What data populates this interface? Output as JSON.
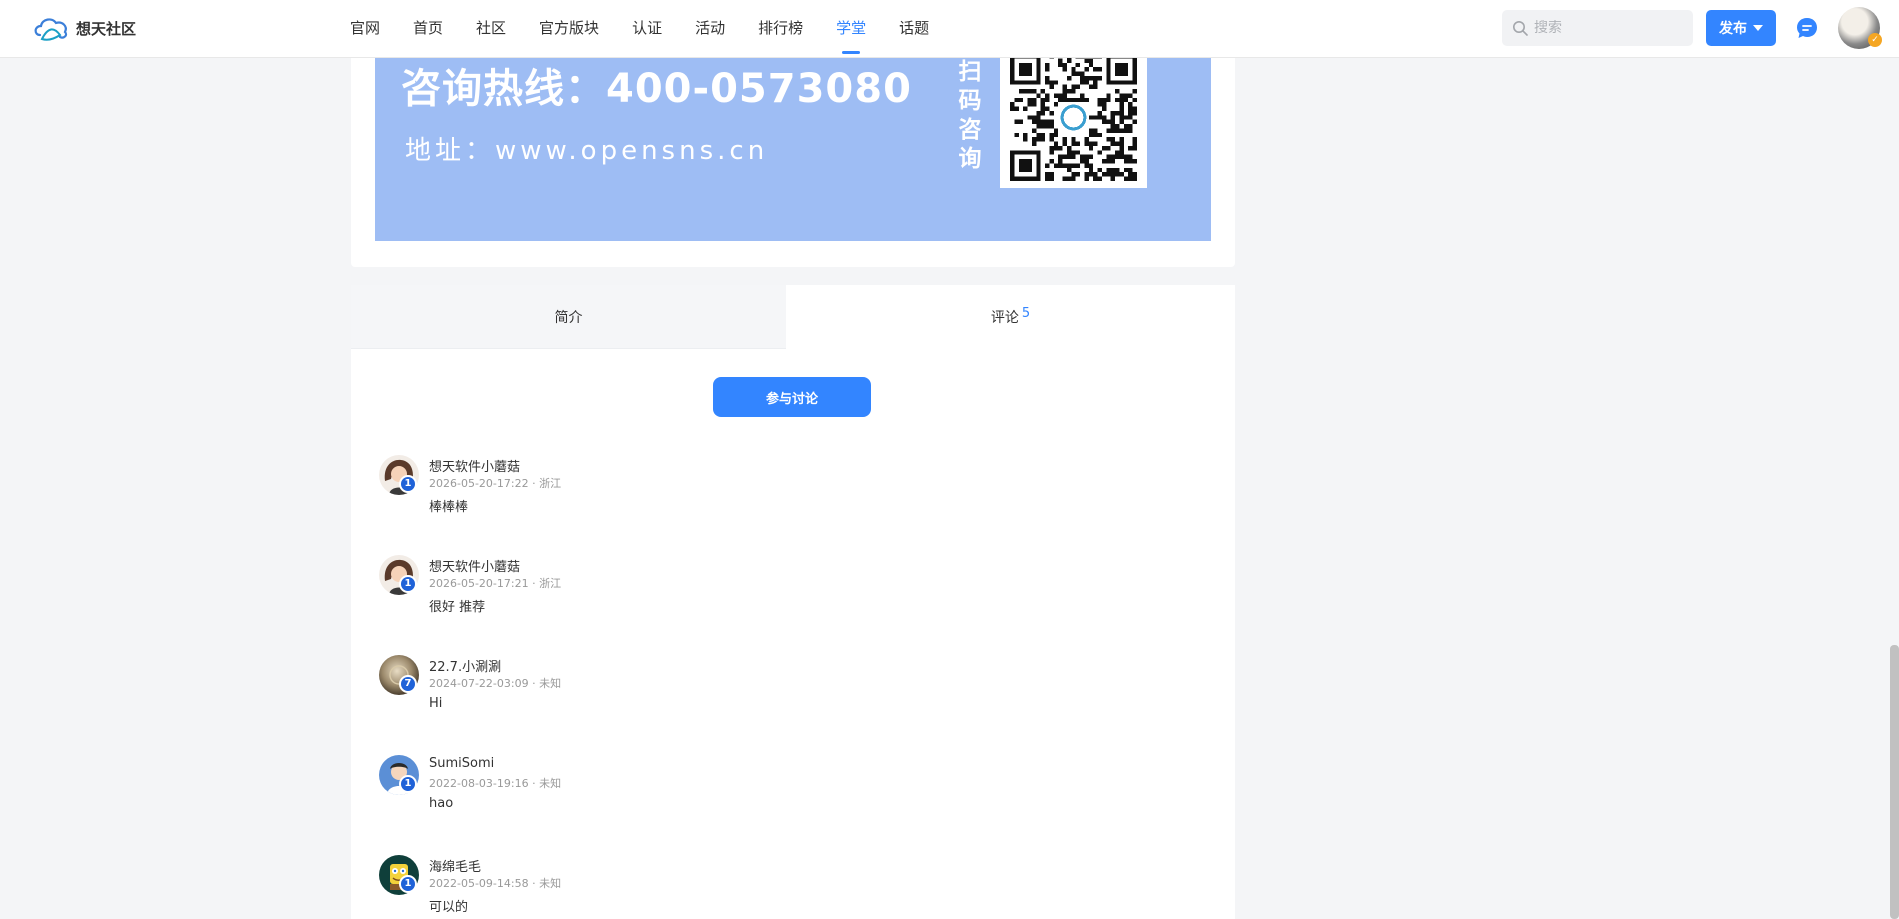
{
  "header": {
    "site_name": "想天社区",
    "nav": [
      "官网",
      "首页",
      "社区",
      "官方版块",
      "认证",
      "活动",
      "排行榜",
      "学堂",
      "话题"
    ],
    "active_nav": "学堂",
    "search_placeholder": "搜索",
    "publish_label": "发布",
    "icons": {
      "logo": "cloud-logo-icon",
      "search": "search-icon",
      "message": "chat-bubble-icon",
      "caret": "caret-down-icon"
    },
    "accent_color": "#3385ff"
  },
  "banner": {
    "hotline": "咨询热线：400-0573080",
    "address": "地址：www.opensns.cn",
    "scan_text": [
      "扫",
      "码",
      "咨",
      "询"
    ],
    "background_color": "#9ebdf4"
  },
  "tabs": {
    "intro_label": "简介",
    "comments_label": "评论",
    "comments_count": "5",
    "active": "评论"
  },
  "join_button_label": "参与讨论",
  "comments": [
    {
      "name": "想天软件小蘑菇",
      "meta": "2026-05-20-17:22 · 浙江",
      "text": "棒棒棒",
      "level": "1",
      "avatar": "cartoon-girl-avatar"
    },
    {
      "name": "想天软件小蘑菇",
      "meta": "2026-05-20-17:21 · 浙江",
      "text": "很好 推荐",
      "level": "1",
      "avatar": "cartoon-girl-avatar"
    },
    {
      "name": "22.7.小涮涮",
      "meta": "2024-07-22-03:09 · 未知",
      "text": "Hi",
      "level": "7",
      "avatar": "gold-disc-avatar"
    },
    {
      "name": "SumiSomi",
      "meta": "2022-08-03-19:16 · 未知",
      "text": "hao",
      "level": "1",
      "avatar": "cartoon-boy-avatar"
    },
    {
      "name": "海绵毛毛",
      "meta": "2022-05-09-14:58 · 未知",
      "text": "可以的",
      "level": "1",
      "avatar": "sponge-avatar"
    }
  ]
}
